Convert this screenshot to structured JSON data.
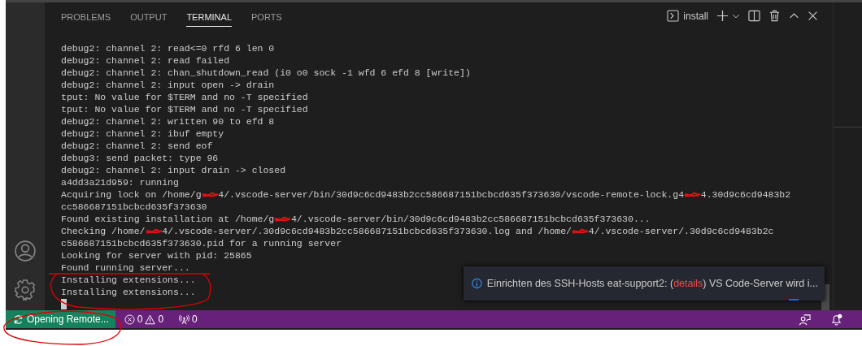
{
  "panel": {
    "tabs": [
      {
        "label": "PROBLEMS",
        "selected": false
      },
      {
        "label": "OUTPUT",
        "selected": false
      },
      {
        "label": "TERMINAL",
        "selected": true
      },
      {
        "label": "PORTS",
        "selected": false
      }
    ],
    "terminal_name": "install"
  },
  "terminal": {
    "lines": [
      {
        "parts": [
          "debug2: channel 2: read<=0 rfd 6 len 0"
        ]
      },
      {
        "parts": [
          "debug2: channel 2: read failed"
        ]
      },
      {
        "parts": [
          "debug2: channel 2: chan_shutdown_read (i0 o0 sock -1 wfd 6 efd 8 [write])"
        ]
      },
      {
        "parts": [
          "debug2: channel 2: input open -> drain"
        ]
      },
      {
        "parts": [
          "tput: No value for $TERM and no -T specified"
        ]
      },
      {
        "parts": [
          "tput: No value for $TERM and no -T specified"
        ]
      },
      {
        "parts": [
          "debug2: channel 2: written 90 to efd 8"
        ]
      },
      {
        "parts": [
          "debug2: channel 2: ibuf empty"
        ]
      },
      {
        "parts": [
          "debug2: channel 2: send eof"
        ]
      },
      {
        "parts": [
          "debug3: send packet: type 96"
        ]
      },
      {
        "parts": [
          "debug2: channel 2: input drain -> closed"
        ]
      },
      {
        "parts": [
          "a4dd3a21d959: running"
        ]
      },
      {
        "parts": [
          "Acquiring lock on /home/g",
          {
            "kind": "redaction"
          },
          "4/.vscode-server/bin/30d9c6cd9483b2cc586687151bcbcd635f373630/vscode-remote-lock.g4",
          {
            "kind": "redaction"
          },
          "4.30d9c6cd9483b2"
        ]
      },
      {
        "parts": [
          "cc586687151bcbcd635f373630"
        ]
      },
      {
        "parts": [
          "Found existing installation at /home/g",
          {
            "kind": "redaction"
          },
          "4/.vscode-server/bin/30d9c6cd9483b2cc586687151bcbcd635f373630..."
        ]
      },
      {
        "parts": [
          "Checking /home/",
          {
            "kind": "redaction"
          },
          "4/.vscode-server/.30d9c6cd9483b2cc586687151bcbcd635f373630.log and /home/",
          {
            "kind": "redaction"
          },
          "4/.vscode-server/.30d9c6cd9483b2c"
        ]
      },
      {
        "parts": [
          "c586687151bcbcd635f373630.pid for a running server"
        ]
      },
      {
        "parts": [
          "Looking for server with pid: 25865"
        ]
      },
      {
        "parts": [
          "Found running server..."
        ]
      },
      {
        "parts": [
          "Installing extensions..."
        ]
      },
      {
        "parts": [
          "Installing extensions..."
        ]
      }
    ],
    "cursor": true
  },
  "notification": {
    "text_before": "Einrichten des SSH-Hosts eat-support2: (",
    "link": "details",
    "text_after": ") VS Code-Server wird i..."
  },
  "status_bar": {
    "remote": "Opening Remote...",
    "errors": "0",
    "warnings": "0",
    "ports": "0",
    "unread_notifications": true
  },
  "annotations": [
    {
      "kind": "underline"
    },
    {
      "kind": "loop"
    },
    {
      "kind": "ellipse"
    }
  ]
}
